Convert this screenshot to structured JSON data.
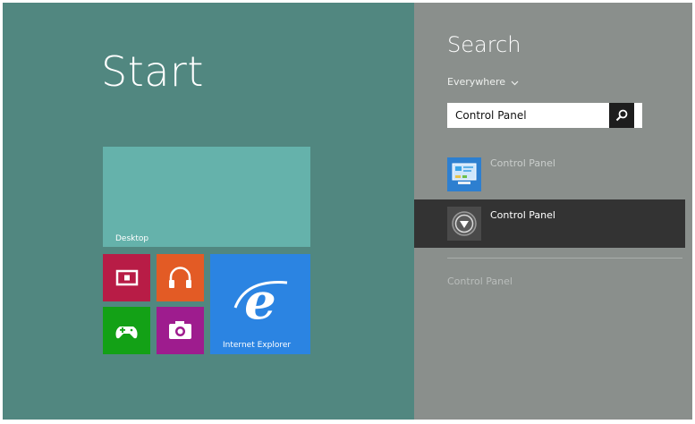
{
  "start": {
    "title": "Start",
    "tiles": {
      "desktop": "Desktop",
      "internet_explorer": "Internet Explorer"
    }
  },
  "search": {
    "title": "Search",
    "scope": "Everywhere",
    "input_value": "Control Panel",
    "results": [
      {
        "label": "Control Panel",
        "icon": "control-panel-icon"
      },
      {
        "label": "Control Panel",
        "icon": "settings-dial-icon"
      }
    ],
    "more_link": "Control Panel"
  },
  "colors": {
    "start_background": "#518780",
    "search_pane": "#8a8f8c",
    "selected_result": "#333333",
    "desktop_tile": "#65b2ab",
    "video_tile": "#b81c46",
    "music_tile": "#e35b25",
    "games_tile": "#13a116",
    "camera_tile": "#9e1c8e",
    "ie_tile": "#2b84e2"
  }
}
